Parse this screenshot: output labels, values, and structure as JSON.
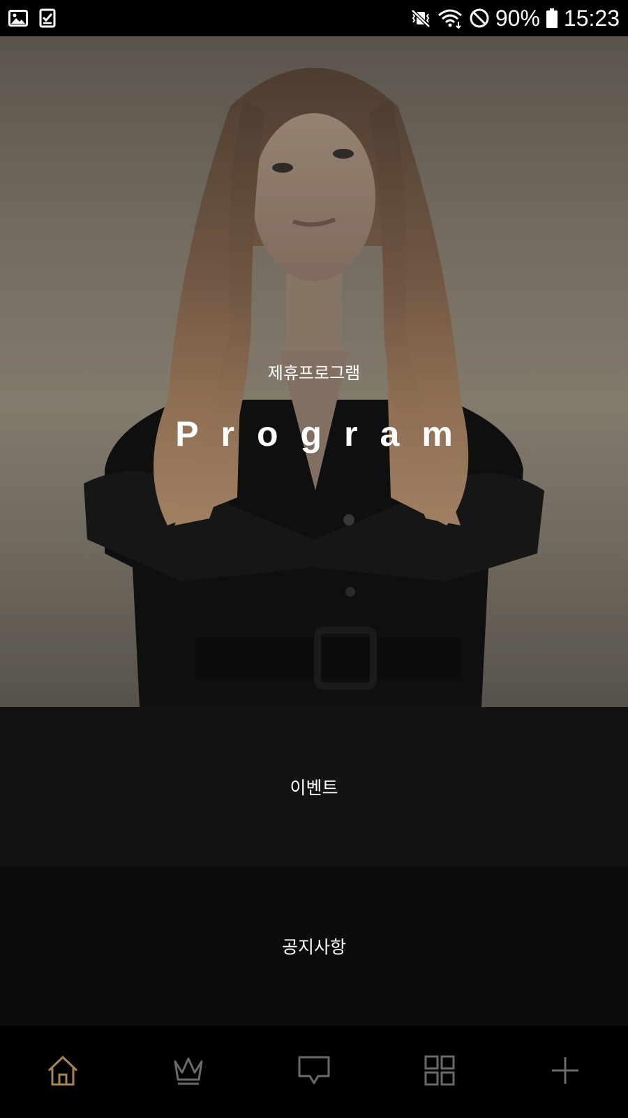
{
  "status_bar": {
    "battery": "90%",
    "time": "15:23",
    "left_icons": [
      "image-icon",
      "checklist-icon"
    ],
    "right_icons": [
      "vibrate-mute-icon",
      "wifi-icon",
      "block-icon",
      "battery-icon"
    ]
  },
  "hero": {
    "subtitle": "제휴프로그램",
    "title": "Program"
  },
  "menu": {
    "items": [
      {
        "label": "이벤트"
      },
      {
        "label": "공지사항"
      }
    ]
  },
  "bottom_nav": {
    "items": [
      {
        "icon": "home-icon",
        "active": true
      },
      {
        "icon": "crown-icon",
        "active": false
      },
      {
        "icon": "chat-icon",
        "active": false
      },
      {
        "icon": "grid-icon",
        "active": false
      },
      {
        "icon": "plus-icon",
        "active": false
      }
    ]
  },
  "colors": {
    "accent": "#a4865a",
    "inactive_icon": "#6a6a6a"
  }
}
